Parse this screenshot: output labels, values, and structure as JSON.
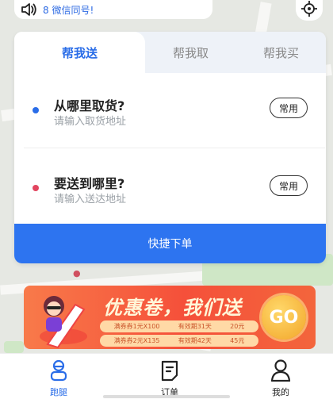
{
  "notice": {
    "text": "8 微信同号!",
    "icon": "speaker-icon"
  },
  "locate": {
    "icon": "locate-icon"
  },
  "tabs": [
    {
      "label": "帮我送",
      "active": true
    },
    {
      "label": "帮我取",
      "active": false
    },
    {
      "label": "帮我买",
      "active": false
    }
  ],
  "pickup": {
    "title": "从哪里取货?",
    "placeholder": "请输入取货地址",
    "freq_label": "常用",
    "dot_color": "#2a6de8"
  },
  "delivery": {
    "title": "要送到哪里?",
    "placeholder": "请输入送达地址",
    "freq_label": "常用",
    "dot_color": "#e2455f"
  },
  "order_button": {
    "label": "快捷下单"
  },
  "banner": {
    "headline": "优惠卷，我们送",
    "coupons": [
      {
        "left": "满券券1元X100",
        "mid": "有效期31天",
        "right": "20元"
      },
      {
        "left": "满券券2元X135",
        "mid": "有效期42天",
        "right": "45元"
      }
    ],
    "go_label": "GO"
  },
  "nav": [
    {
      "label": "跑腿",
      "icon": "errand-icon",
      "active": true
    },
    {
      "label": "订单",
      "icon": "order-icon",
      "active": false
    },
    {
      "label": "我的",
      "icon": "profile-icon",
      "active": false
    }
  ],
  "colors": {
    "accent": "#2a6de8",
    "button": "#2d74f0",
    "delivery_dot": "#e2455f"
  }
}
